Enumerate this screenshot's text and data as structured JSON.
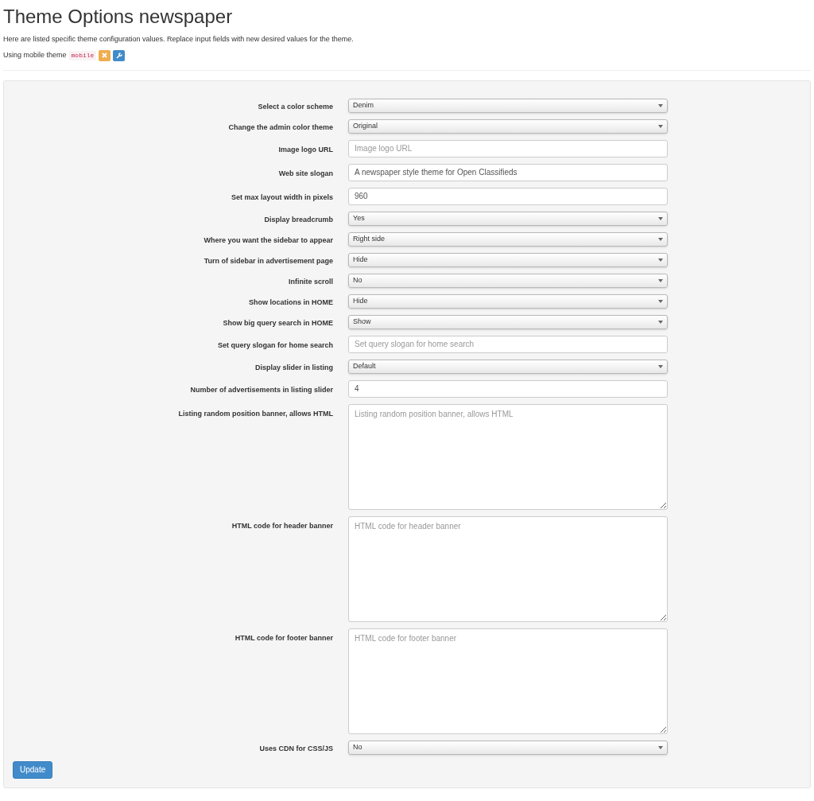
{
  "header": {
    "title": "Theme Options newspaper",
    "description": "Here are listed specific theme configuration values. Replace input fields with new desired values for the theme.",
    "mobile_theme": {
      "label": "Using mobile theme",
      "code": "mobile"
    }
  },
  "form": {
    "fields": [
      {
        "kind": "select",
        "label": "Select a color scheme",
        "value": "Denim"
      },
      {
        "kind": "select",
        "label": "Change the admin color theme",
        "value": "Original"
      },
      {
        "kind": "text",
        "label": "Image logo URL",
        "placeholder": "Image logo URL"
      },
      {
        "kind": "text",
        "label": "Web site slogan",
        "value": "A newspaper style theme for Open Classifieds"
      },
      {
        "kind": "text",
        "label": "Set max layout width in pixels",
        "value": "960"
      },
      {
        "kind": "select",
        "label": "Display breadcrumb",
        "value": "Yes"
      },
      {
        "kind": "select",
        "label": "Where you want the sidebar to appear",
        "value": "Right side"
      },
      {
        "kind": "select",
        "label": "Turn of sidebar in advertisement page",
        "value": "Hide"
      },
      {
        "kind": "select",
        "label": "Infinite scroll",
        "value": "No"
      },
      {
        "kind": "select",
        "label": "Show locations in HOME",
        "value": "Hide"
      },
      {
        "kind": "select",
        "label": "Show big query search in HOME",
        "value": "Show"
      },
      {
        "kind": "text",
        "label": "Set query slogan for home search",
        "placeholder": "Set query slogan for home search"
      },
      {
        "kind": "select",
        "label": "Display slider in listing",
        "value": "Default"
      },
      {
        "kind": "text",
        "label": "Number of advertisements in listing slider",
        "value": "4"
      },
      {
        "kind": "textarea",
        "label": "Listing random position banner, allows HTML",
        "placeholder": "Listing random position banner, allows HTML"
      },
      {
        "kind": "textarea",
        "label": "HTML code for header banner",
        "placeholder": "HTML code for header banner"
      },
      {
        "kind": "textarea",
        "label": "HTML code for footer banner",
        "placeholder": "HTML code for footer banner"
      },
      {
        "kind": "select",
        "label": "Uses CDN for CSS/JS",
        "value": "No"
      }
    ],
    "submit": "Update"
  }
}
